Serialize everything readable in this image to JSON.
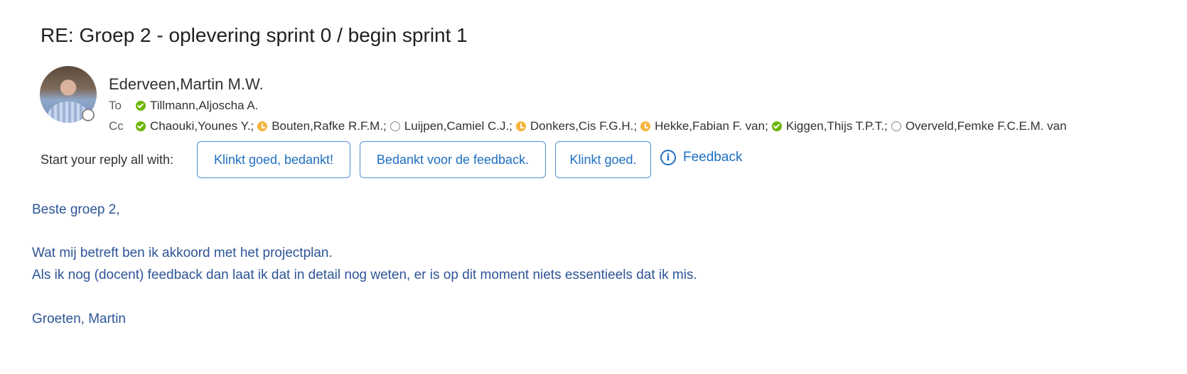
{
  "email": {
    "subject": "RE: Groep 2 - oplevering sprint 0 / begin sprint 1",
    "sender": "Ederveen,Martin M.W.",
    "to_label": "To",
    "cc_label": "Cc",
    "to": [
      {
        "name": "Tillmann,Aljoscha A.",
        "presence": "available"
      }
    ],
    "cc": [
      {
        "name": "Chaouki,Younes Y.;",
        "presence": "available"
      },
      {
        "name": "Bouten,Rafke R.F.M.;",
        "presence": "away"
      },
      {
        "name": "Luijpen,Camiel C.J.;",
        "presence": "offline"
      },
      {
        "name": "Donkers,Cis F.G.H.;",
        "presence": "away"
      },
      {
        "name": "Hekke,Fabian F. van;",
        "presence": "away"
      },
      {
        "name": "Kiggen,Thijs T.P.T.;",
        "presence": "available"
      },
      {
        "name": "Overveld,Femke F.C.E.M. van",
        "presence": "offline"
      }
    ]
  },
  "reply": {
    "label": "Start your reply all with:",
    "suggestions": [
      "Klinkt goed, bedankt!",
      "Bedankt voor de feedback.",
      "Klinkt goed."
    ],
    "feedback_label": "Feedback",
    "feedback_icon": "info-icon"
  },
  "body": {
    "greeting": "Beste groep 2,",
    "line1": "Wat mij betreft ben ik akkoord met het projectplan.",
    "line2": "Als ik nog (docent) feedback dan laat ik dat in detail nog weten, er is op dit moment niets essentieels dat ik mis.",
    "closing": "Groeten, Martin"
  },
  "colors": {
    "available": "#6bb700",
    "away": "#f8b43c",
    "offline": "#8a8886",
    "link": "#1e6fc2",
    "body_text": "#2e5597"
  }
}
